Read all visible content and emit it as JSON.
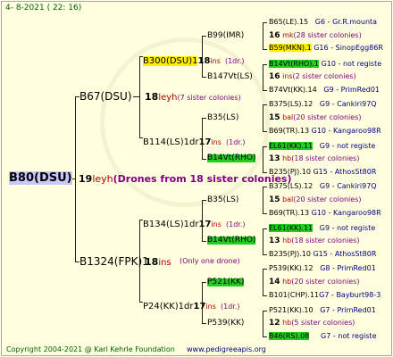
{
  "header": {
    "date": "4-  8-2021  (  22:  16)"
  },
  "footer": {
    "copyright": "Copyright 2004-2021 @ Karl Kehrle Foundation",
    "website": "www.pedigreeapis.org"
  },
  "gen1": {
    "root": "B80(DSU)",
    "num": "19",
    "ins": "leyh",
    "label": "(Drones from 18 sister colonies)"
  },
  "gen2": [
    {
      "id": "B67(DSU)",
      "num": "18",
      "ins": "leyh",
      "label": "(7 sister colonies)"
    },
    {
      "id": "B1324(FPK)1",
      "num": "18",
      "ins": "ins",
      "label": "(Only one drone)"
    }
  ],
  "gen3": [
    {
      "id": "B300(DSU)1",
      "num": "18",
      "ins": "ins",
      "label": "(1dr.)"
    },
    {
      "id": "B114(LS)1dr",
      "num": "17",
      "ins": "ins",
      "label": "(1dr.)"
    },
    {
      "id": "B134(LS)1dr",
      "num": "17",
      "ins": "ins",
      "label": "(1dr.)"
    },
    {
      "id": "P24(KK)1dr",
      "num": "17",
      "ins": "ins",
      "label": "(1dr.)"
    }
  ],
  "gen4": [
    {
      "id": "B99(IMR)"
    },
    {
      "id": "B147Vt(LS)"
    },
    {
      "id": "B35(LS)"
    },
    {
      "id": "B14Vt(RHO)"
    },
    {
      "id": "B35(LS)"
    },
    {
      "id": "B14Vt(RHO)"
    },
    {
      "id": "P521(KK)"
    },
    {
      "id": "P539(KK)"
    }
  ],
  "gen5": [
    {
      "id": "B65(LE).15",
      "c1": "G6",
      "c2": "Gr.R.mounta"
    },
    {
      "num": "16",
      "ins": "mk",
      "label": "(28 sister colonies)"
    },
    {
      "id": "B59(MKN).1",
      "c1": "G16",
      "c2": "SinopEgg86R"
    },
    {
      "id": "B14Vt(RHO).1",
      "c1": "G10",
      "c2": "not registe"
    },
    {
      "num": "16",
      "ins": "ins",
      "label": "(2 sister colonies)"
    },
    {
      "id": "B74Vt(KK).14",
      "c1": "G9",
      "c2": "PrimRed01"
    },
    {
      "id": "B375(LS).12",
      "c1": "G9",
      "c2": "Cankiri97Q"
    },
    {
      "num": "15",
      "ins": "bal",
      "label": "(20 sister colonies)"
    },
    {
      "id": "B69(TR).13",
      "c1": "G10",
      "c2": "Kangaroo98R"
    },
    {
      "id": "EL61(KK).11",
      "c1": "G9",
      "c2": "not registe"
    },
    {
      "num": "13",
      "ins": "hb",
      "label": "(18 sister colonies)"
    },
    {
      "id": "B235(PJ).10",
      "c1": "G15",
      "c2": "AthosSt80R"
    },
    {
      "id": "B375(LS).12",
      "c1": "G9",
      "c2": "Cankiri97Q"
    },
    {
      "num": "15",
      "ins": "bal",
      "label": "(20 sister colonies)"
    },
    {
      "id": "B69(TR).13",
      "c1": "G10",
      "c2": "Kangaroo98R"
    },
    {
      "id": "EL61(KK).11",
      "c1": "G9",
      "c2": "not registe"
    },
    {
      "num": "13",
      "ins": "hb",
      "label": "(18 sister colonies)"
    },
    {
      "id": "B235(PJ).10",
      "c1": "G15",
      "c2": "AthosSt80R"
    },
    {
      "id": "P539(KK).12",
      "c1": "G8",
      "c2": "PrimRed01"
    },
    {
      "num": "14",
      "ins": "hb",
      "label": "(20 sister colonies)"
    },
    {
      "id": "B101(CHP).11",
      "c1": "G7",
      "c2": "Bayburt98-3"
    },
    {
      "id": "P521(KK).10",
      "c1": "G7",
      "c2": "PrimRed01"
    },
    {
      "num": "12",
      "ins": "hb",
      "label": "(5 sister colonies)"
    },
    {
      "id": "B46(RS).08",
      "c1": "G7",
      "c2": "not registe"
    }
  ]
}
